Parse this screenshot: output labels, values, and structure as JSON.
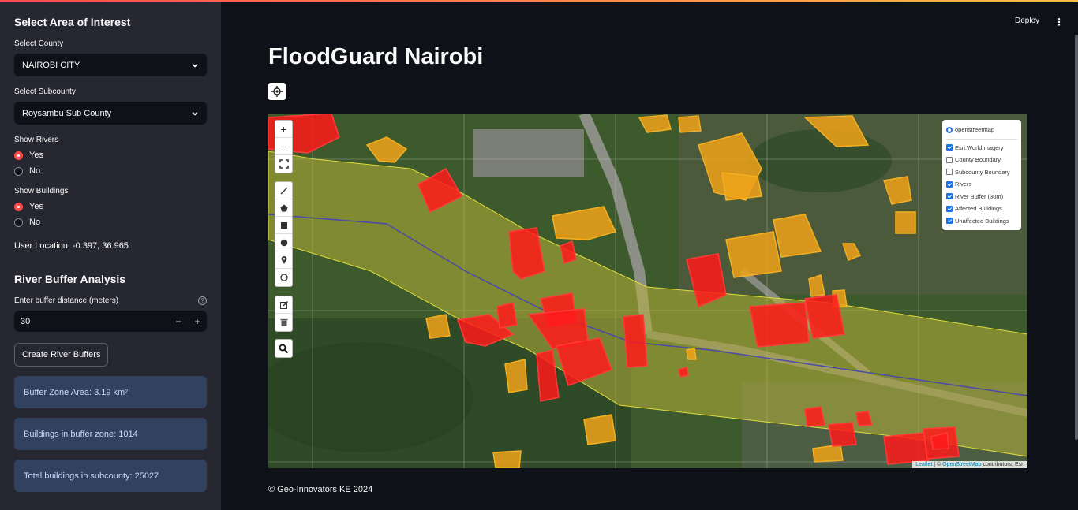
{
  "sidebar": {
    "heading": "Select Area of Interest",
    "county_label": "Select County",
    "county_value": "NAIROBI CITY",
    "subcounty_label": "Select Subcounty",
    "subcounty_value": "Roysambu Sub County",
    "rivers_label": "Show Rivers",
    "rivers_options": [
      "Yes",
      "No"
    ],
    "rivers_selected": "Yes",
    "buildings_label": "Show Buildings",
    "buildings_options": [
      "Yes",
      "No"
    ],
    "buildings_selected": "Yes",
    "user_location": "User Location: -0.397, 36.965",
    "analysis_heading": "River Buffer Analysis",
    "buffer_label": "Enter buffer distance (meters)",
    "buffer_value": "30",
    "minus": "−",
    "plus": "+",
    "create_button": "Create River Buffers",
    "buffer_area": "Buffer Zone Area: 3.19 km",
    "buffer_area_unit_sup": "2",
    "buildings_in_zone": "Buildings in buffer zone: 1014",
    "total_buildings": "Total buildings in subcounty: 25027"
  },
  "header": {
    "deploy": "Deploy",
    "menu": "⋮"
  },
  "main": {
    "title": "FloodGuard Nairobi",
    "footer": "© Geo-Innovators KE 2024"
  },
  "map": {
    "zoom_in": "+",
    "zoom_out": "−",
    "layers": {
      "base": [
        {
          "label": "openstreetmap",
          "selected": true
        }
      ],
      "overlays": [
        {
          "label": "Esri.WorldImagery",
          "checked": true
        },
        {
          "label": "County Boundary",
          "checked": false
        },
        {
          "label": "Subcounty Boundary",
          "checked": false
        },
        {
          "label": "Rivers",
          "checked": true
        },
        {
          "label": "River Buffer (30m)",
          "checked": true
        },
        {
          "label": "Affected Buildings",
          "checked": true
        },
        {
          "label": "Unaffected Buildings",
          "checked": true
        }
      ]
    },
    "attribution": {
      "leaflet": "Leaflet",
      "sep": " | © ",
      "osm": "OpenStreetMap",
      "rest": " contributors, Esri"
    },
    "colors": {
      "affected": "#ff1a1a",
      "unaffected": "#f0a21a",
      "buffer": "#c8c23a",
      "river": "#4a4aa8"
    }
  }
}
